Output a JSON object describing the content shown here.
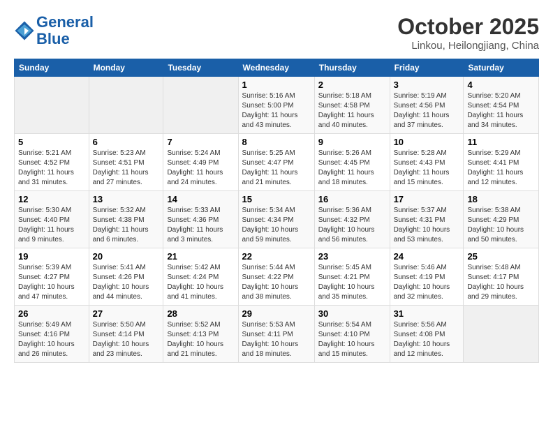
{
  "header": {
    "logo_line1": "General",
    "logo_line2": "Blue",
    "month": "October 2025",
    "location": "Linkou, Heilongjiang, China"
  },
  "weekdays": [
    "Sunday",
    "Monday",
    "Tuesday",
    "Wednesday",
    "Thursday",
    "Friday",
    "Saturday"
  ],
  "weeks": [
    [
      {
        "num": "",
        "info": ""
      },
      {
        "num": "",
        "info": ""
      },
      {
        "num": "",
        "info": ""
      },
      {
        "num": "1",
        "info": "Sunrise: 5:16 AM\nSunset: 5:00 PM\nDaylight: 11 hours\nand 43 minutes."
      },
      {
        "num": "2",
        "info": "Sunrise: 5:18 AM\nSunset: 4:58 PM\nDaylight: 11 hours\nand 40 minutes."
      },
      {
        "num": "3",
        "info": "Sunrise: 5:19 AM\nSunset: 4:56 PM\nDaylight: 11 hours\nand 37 minutes."
      },
      {
        "num": "4",
        "info": "Sunrise: 5:20 AM\nSunset: 4:54 PM\nDaylight: 11 hours\nand 34 minutes."
      }
    ],
    [
      {
        "num": "5",
        "info": "Sunrise: 5:21 AM\nSunset: 4:52 PM\nDaylight: 11 hours\nand 31 minutes."
      },
      {
        "num": "6",
        "info": "Sunrise: 5:23 AM\nSunset: 4:51 PM\nDaylight: 11 hours\nand 27 minutes."
      },
      {
        "num": "7",
        "info": "Sunrise: 5:24 AM\nSunset: 4:49 PM\nDaylight: 11 hours\nand 24 minutes."
      },
      {
        "num": "8",
        "info": "Sunrise: 5:25 AM\nSunset: 4:47 PM\nDaylight: 11 hours\nand 21 minutes."
      },
      {
        "num": "9",
        "info": "Sunrise: 5:26 AM\nSunset: 4:45 PM\nDaylight: 11 hours\nand 18 minutes."
      },
      {
        "num": "10",
        "info": "Sunrise: 5:28 AM\nSunset: 4:43 PM\nDaylight: 11 hours\nand 15 minutes."
      },
      {
        "num": "11",
        "info": "Sunrise: 5:29 AM\nSunset: 4:41 PM\nDaylight: 11 hours\nand 12 minutes."
      }
    ],
    [
      {
        "num": "12",
        "info": "Sunrise: 5:30 AM\nSunset: 4:40 PM\nDaylight: 11 hours\nand 9 minutes."
      },
      {
        "num": "13",
        "info": "Sunrise: 5:32 AM\nSunset: 4:38 PM\nDaylight: 11 hours\nand 6 minutes."
      },
      {
        "num": "14",
        "info": "Sunrise: 5:33 AM\nSunset: 4:36 PM\nDaylight: 11 hours\nand 3 minutes."
      },
      {
        "num": "15",
        "info": "Sunrise: 5:34 AM\nSunset: 4:34 PM\nDaylight: 10 hours\nand 59 minutes."
      },
      {
        "num": "16",
        "info": "Sunrise: 5:36 AM\nSunset: 4:32 PM\nDaylight: 10 hours\nand 56 minutes."
      },
      {
        "num": "17",
        "info": "Sunrise: 5:37 AM\nSunset: 4:31 PM\nDaylight: 10 hours\nand 53 minutes."
      },
      {
        "num": "18",
        "info": "Sunrise: 5:38 AM\nSunset: 4:29 PM\nDaylight: 10 hours\nand 50 minutes."
      }
    ],
    [
      {
        "num": "19",
        "info": "Sunrise: 5:39 AM\nSunset: 4:27 PM\nDaylight: 10 hours\nand 47 minutes."
      },
      {
        "num": "20",
        "info": "Sunrise: 5:41 AM\nSunset: 4:26 PM\nDaylight: 10 hours\nand 44 minutes."
      },
      {
        "num": "21",
        "info": "Sunrise: 5:42 AM\nSunset: 4:24 PM\nDaylight: 10 hours\nand 41 minutes."
      },
      {
        "num": "22",
        "info": "Sunrise: 5:44 AM\nSunset: 4:22 PM\nDaylight: 10 hours\nand 38 minutes."
      },
      {
        "num": "23",
        "info": "Sunrise: 5:45 AM\nSunset: 4:21 PM\nDaylight: 10 hours\nand 35 minutes."
      },
      {
        "num": "24",
        "info": "Sunrise: 5:46 AM\nSunset: 4:19 PM\nDaylight: 10 hours\nand 32 minutes."
      },
      {
        "num": "25",
        "info": "Sunrise: 5:48 AM\nSunset: 4:17 PM\nDaylight: 10 hours\nand 29 minutes."
      }
    ],
    [
      {
        "num": "26",
        "info": "Sunrise: 5:49 AM\nSunset: 4:16 PM\nDaylight: 10 hours\nand 26 minutes."
      },
      {
        "num": "27",
        "info": "Sunrise: 5:50 AM\nSunset: 4:14 PM\nDaylight: 10 hours\nand 23 minutes."
      },
      {
        "num": "28",
        "info": "Sunrise: 5:52 AM\nSunset: 4:13 PM\nDaylight: 10 hours\nand 21 minutes."
      },
      {
        "num": "29",
        "info": "Sunrise: 5:53 AM\nSunset: 4:11 PM\nDaylight: 10 hours\nand 18 minutes."
      },
      {
        "num": "30",
        "info": "Sunrise: 5:54 AM\nSunset: 4:10 PM\nDaylight: 10 hours\nand 15 minutes."
      },
      {
        "num": "31",
        "info": "Sunrise: 5:56 AM\nSunset: 4:08 PM\nDaylight: 10 hours\nand 12 minutes."
      },
      {
        "num": "",
        "info": ""
      }
    ]
  ]
}
